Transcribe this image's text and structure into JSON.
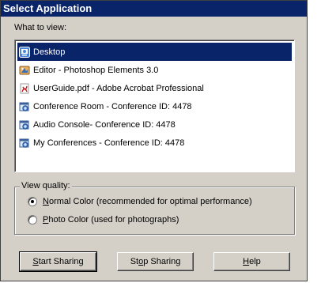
{
  "window": {
    "title": "Select Application"
  },
  "what_to_view": {
    "label": "What to view:",
    "items": [
      {
        "label": "Desktop",
        "icon": "desktop-icon",
        "selected": true
      },
      {
        "label": "Editor - Photoshop Elements 3.0",
        "icon": "photoshop-icon",
        "selected": false
      },
      {
        "label": "UserGuide.pdf - Adobe Acrobat Professional",
        "icon": "pdf-icon",
        "selected": false
      },
      {
        "label": "Conference Room - Conference ID: 4478",
        "icon": "conference-app-icon",
        "selected": false
      },
      {
        "label": "Audio Console- Conference ID: 4478",
        "icon": "conference-app-icon",
        "selected": false
      },
      {
        "label": "My Conferences - Conference ID: 4478",
        "icon": "conference-app-icon",
        "selected": false
      }
    ]
  },
  "view_quality": {
    "legend": "View quality:",
    "options": [
      {
        "accel": "N",
        "rest": "ormal Color (recommended for optimal performance)",
        "checked": true
      },
      {
        "accel": "P",
        "rest": "hoto Color (used for photographs)",
        "checked": false
      }
    ]
  },
  "buttons": {
    "start": {
      "accel": "S",
      "rest": "tart Sharing"
    },
    "stop": {
      "pre": "St",
      "accel": "o",
      "rest": "p Sharing"
    },
    "help": {
      "accel": "H",
      "rest": "elp"
    }
  },
  "colors": {
    "titlebar": "#0a246a",
    "selection": "#0a246a",
    "dialog_face": "#d4d0c8"
  }
}
